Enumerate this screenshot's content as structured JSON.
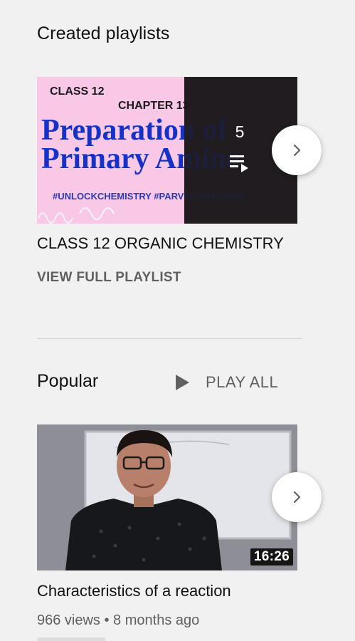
{
  "created_playlists": {
    "heading": "Created playlists",
    "playlist": {
      "thumbnail_text": {
        "class_line": "CLASS 12",
        "chapter_line": "CHAPTER 13",
        "title_line1": "Preparation of",
        "title_line2": "Primary Amine",
        "hashtags": "#UNLOCKCHEMISTRY #PARVESHNARANG"
      },
      "video_count": "5",
      "title": "CLASS 12 ORGANIC CHEMISTRY",
      "view_full_label": "VIEW FULL PLAYLIST",
      "icon": "playlist-icon",
      "next_icon": "chevron-right-icon"
    }
  },
  "popular": {
    "heading": "Popular",
    "play_all_label": "PLAY ALL",
    "play_icon": "play-icon",
    "video": {
      "duration": "16:26",
      "title": "Characteristics of a reaction",
      "meta": "966 views • 8 months ago",
      "next_icon": "chevron-right-icon"
    }
  },
  "colors": {
    "background": "#f1f1f1",
    "thumbnail_pink": "#f9c8e7",
    "thumbnail_blue_text": "#1532c8",
    "secondary_text": "#606060"
  }
}
